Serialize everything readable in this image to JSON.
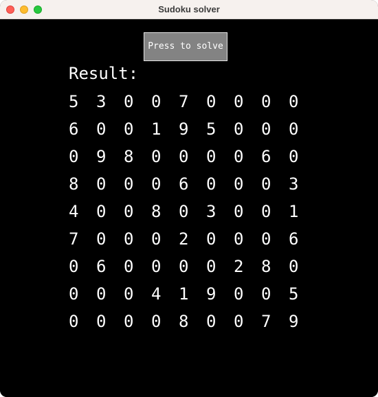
{
  "window": {
    "title": "Sudoku solver"
  },
  "toolbar": {
    "solve_label": "Press to solve"
  },
  "result": {
    "label": "Result:",
    "grid": [
      [
        "5",
        "3",
        "0",
        "0",
        "7",
        "0",
        "0",
        "0",
        "0"
      ],
      [
        "6",
        "0",
        "0",
        "1",
        "9",
        "5",
        "0",
        "0",
        "0"
      ],
      [
        "0",
        "9",
        "8",
        "0",
        "0",
        "0",
        "0",
        "6",
        "0"
      ],
      [
        "8",
        "0",
        "0",
        "0",
        "6",
        "0",
        "0",
        "0",
        "3"
      ],
      [
        "4",
        "0",
        "0",
        "8",
        "0",
        "3",
        "0",
        "0",
        "1"
      ],
      [
        "7",
        "0",
        "0",
        "0",
        "2",
        "0",
        "0",
        "0",
        "6"
      ],
      [
        "0",
        "6",
        "0",
        "0",
        "0",
        "0",
        "2",
        "8",
        "0"
      ],
      [
        "0",
        "0",
        "0",
        "4",
        "1",
        "9",
        "0",
        "0",
        "5"
      ],
      [
        "0",
        "0",
        "0",
        "0",
        "8",
        "0",
        "0",
        "7",
        "9"
      ]
    ]
  },
  "colors": {
    "background": "#000000",
    "button_fill": "#838383",
    "button_border": "#e6e6e6",
    "text": "#ffffff",
    "titlebar": "#f6f1ee"
  }
}
